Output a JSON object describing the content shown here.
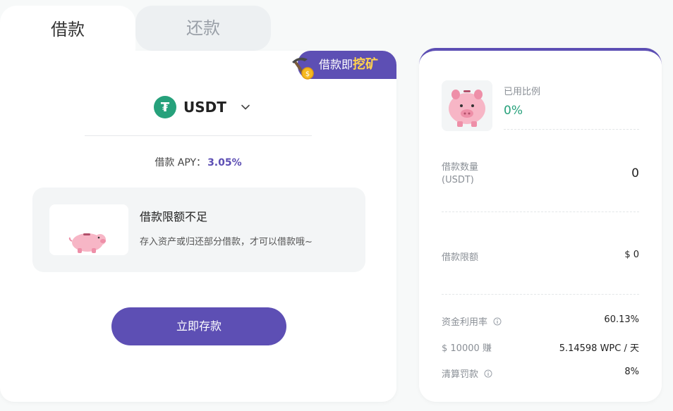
{
  "tabs": [
    {
      "label": "借款",
      "active": true
    },
    {
      "label": "还款",
      "active": false
    }
  ],
  "badge": {
    "text": "借款即",
    "highlight": "挖矿"
  },
  "token": {
    "symbol": "USDT",
    "logo_glyph": "₮"
  },
  "apy": {
    "label": "借款 APY：",
    "value": "3.05%"
  },
  "notice": {
    "title": "借款限额不足",
    "description": "存入资产或归还部分借款，才可以借款哦~"
  },
  "deposit_button": "立即存款",
  "stats": {
    "used_ratio_label": "已用比例",
    "used_ratio_value": "0%",
    "borrow_amount_label": "借款数量",
    "borrow_amount_unit": "(USDT)",
    "borrow_amount_value": "0",
    "borrow_limit_label": "借款限额",
    "borrow_limit_value": "$ 0",
    "utilization_label": "资金利用率",
    "utilization_value": "60.13%",
    "earn_label": "$ 10000 赚",
    "earn_value": "5.14598 WPC / 天",
    "liquidation_label": "清算罚款",
    "liquidation_value": "8%"
  },
  "colors": {
    "accent": "#5d4fb4",
    "tether_green": "#26a17b",
    "highlight_yellow": "#ffd24d",
    "positive": "#26a17b"
  },
  "icons": {
    "token": "tether-icon",
    "dropdown": "chevron-down-icon",
    "info": "info-circle-icon",
    "illustration": "piggy-bank-icon",
    "badge": "pickaxe-coin-icon"
  }
}
